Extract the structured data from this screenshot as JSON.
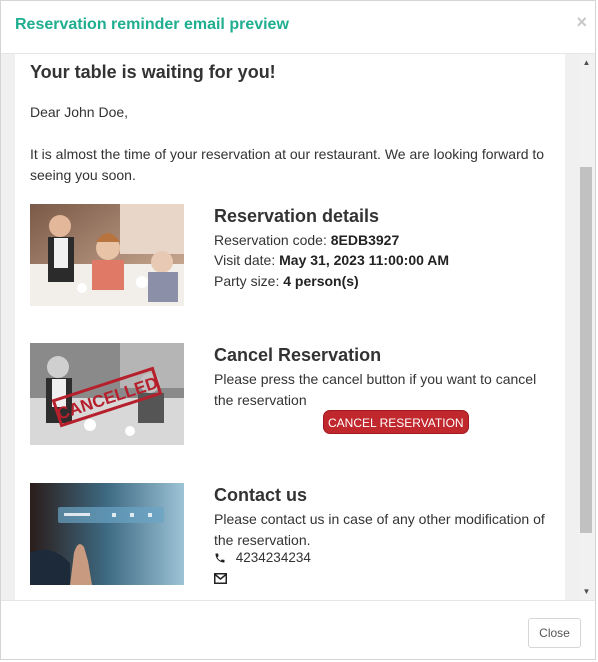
{
  "modal": {
    "title": "Reservation reminder email preview",
    "close_icon": "×",
    "close_button_label": "Close"
  },
  "email": {
    "heading": "Your table is waiting for you!",
    "greeting": "Dear John Doe,",
    "intro": "It is almost the time of your reservation at our restaurant. We are looking forward to seeing you soon.",
    "details": {
      "title": "Reservation details",
      "code_label": "Reservation code: ",
      "code_value": "8EDB3927",
      "date_label": "Visit date: ",
      "date_value": "May 31, 2023 11:00:00 AM",
      "party_label": "Party size: ",
      "party_value": "4 person(s)"
    },
    "cancel": {
      "title": "Cancel Reservation",
      "text": "Please press the cancel button if you want to cancel the reservation",
      "button_label": "CANCEL RESERVATION",
      "stamp_text": "CANCELLED"
    },
    "contact": {
      "title": "Contact us",
      "text": "Please contact us in case of any other modification of the reservation.",
      "phone": "4234234234",
      "phone_icon": "phone-icon",
      "mail_icon": "mail-icon"
    }
  },
  "colors": {
    "title": "#1fae8f",
    "cancel_button": "#c0282e"
  }
}
